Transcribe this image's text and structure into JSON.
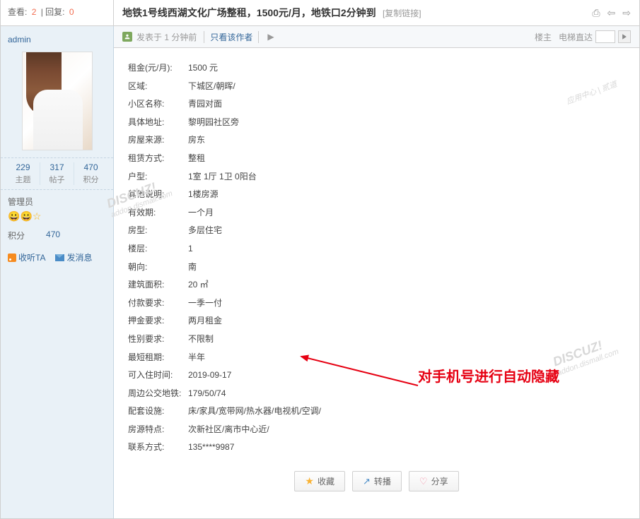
{
  "topbar": {
    "views_label": "查看:",
    "views": "2",
    "replies_label": "回复:",
    "replies": "0",
    "title": "地铁1号线西湖文化广场整租，1500元/月，地铁口2分钟到",
    "copy_link": "[复制链接]"
  },
  "sidebar": {
    "username": "admin",
    "stats": [
      {
        "num": "229",
        "label": "主题"
      },
      {
        "num": "317",
        "label": "帖子"
      },
      {
        "num": "470",
        "label": "积分"
      }
    ],
    "role": "管理员",
    "points_label": "积分",
    "points_value": "470",
    "listen": "收听TA",
    "message": "发消息"
  },
  "metabar": {
    "posted": "发表于 1 分钟前",
    "only_author": "只看该作者",
    "floor": "楼主",
    "elevator": "电梯直达"
  },
  "details": [
    {
      "label": "租金(元/月):",
      "value": "1500 元"
    },
    {
      "label": "区域:",
      "value": "下城区/朝晖/"
    },
    {
      "label": "小区名称:",
      "value": "青园对面"
    },
    {
      "label": "具体地址:",
      "value": "黎明园社区旁"
    },
    {
      "label": "房屋来源:",
      "value": "房东"
    },
    {
      "label": "租赁方式:",
      "value": "整租"
    },
    {
      "label": "户型:",
      "value": "1室 1厅 1卫 0阳台"
    },
    {
      "label": "其他说明:",
      "value": "1楼房源"
    },
    {
      "label": "有效期:",
      "value": "一个月"
    },
    {
      "label": "房型:",
      "value": "多层住宅"
    },
    {
      "label": "楼层:",
      "value": "1"
    },
    {
      "label": "朝向:",
      "value": "南"
    },
    {
      "label": "建筑面积:",
      "value": "20 ㎡"
    },
    {
      "label": "付款要求:",
      "value": "一季一付"
    },
    {
      "label": "押金要求:",
      "value": "两月租金"
    },
    {
      "label": "性别要求:",
      "value": "不限制"
    },
    {
      "label": "最短租期:",
      "value": "半年"
    },
    {
      "label": "可入住时间:",
      "value": "2019-09-17"
    },
    {
      "label": "周边公交地铁:",
      "value": "179/50/74"
    },
    {
      "label": "配套设施:",
      "value": "床/家具/宽带网/热水器/电视机/空调/"
    },
    {
      "label": "房源特点:",
      "value": "次新社区/离市中心近/"
    },
    {
      "label": "联系方式:",
      "value": "135****9987"
    }
  ],
  "annotation": "对手机号进行自动隐藏",
  "watermark_brand": "DISCUZ!",
  "watermark_sub": "应用中心 | 贰道",
  "watermark_url": "addon.dismall.com",
  "footer": {
    "favorite": "收藏",
    "repost": "转播",
    "share": "分享"
  }
}
